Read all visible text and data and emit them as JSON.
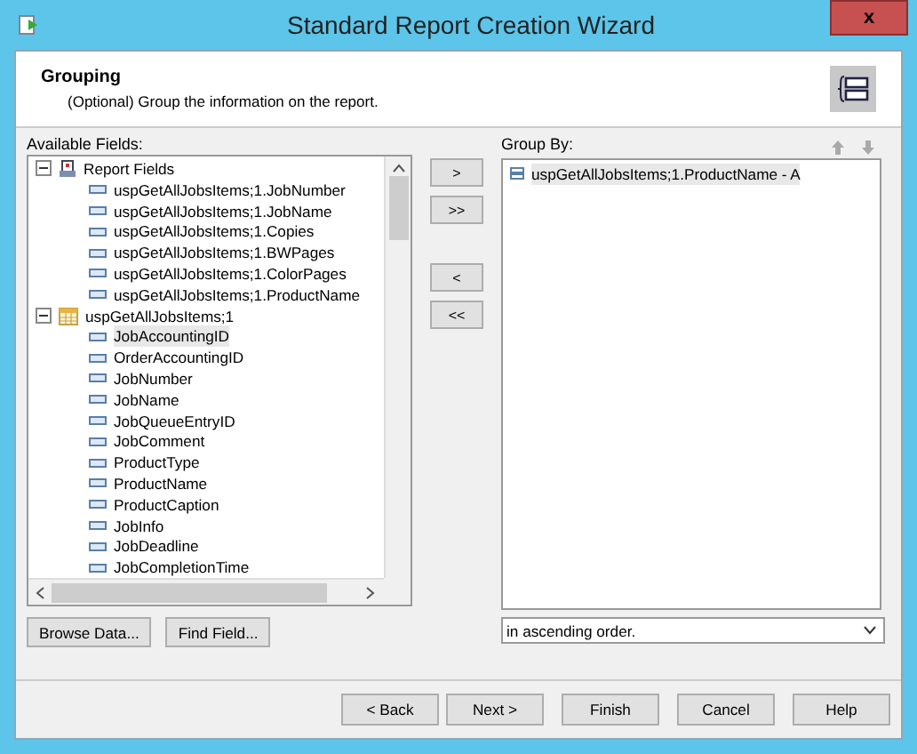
{
  "window": {
    "title": "Standard Report Creation Wizard",
    "close": "x"
  },
  "header": {
    "title": "Grouping",
    "subtitle": "(Optional) Group the information on the report."
  },
  "available_fields": {
    "label": "Available Fields:",
    "tree": [
      {
        "label": "Report Fields",
        "kind": "report",
        "expanded": true,
        "children": [
          {
            "label": "uspGetAllJobsItems;1.JobNumber",
            "selected": false
          },
          {
            "label": "uspGetAllJobsItems;1.JobName",
            "selected": false
          },
          {
            "label": "uspGetAllJobsItems;1.Copies",
            "selected": false
          },
          {
            "label": "uspGetAllJobsItems;1.BWPages",
            "selected": false
          },
          {
            "label": "uspGetAllJobsItems;1.ColorPages",
            "selected": false
          },
          {
            "label": "uspGetAllJobsItems;1.ProductName",
            "selected": false
          }
        ]
      },
      {
        "label": "uspGetAllJobsItems;1",
        "kind": "table",
        "expanded": true,
        "children": [
          {
            "label": "JobAccountingID",
            "selected": true
          },
          {
            "label": "OrderAccountingID",
            "selected": false
          },
          {
            "label": "JobNumber",
            "selected": false
          },
          {
            "label": "JobName",
            "selected": false
          },
          {
            "label": "JobQueueEntryID",
            "selected": false
          },
          {
            "label": "JobComment",
            "selected": false
          },
          {
            "label": "ProductType",
            "selected": false
          },
          {
            "label": "ProductName",
            "selected": false
          },
          {
            "label": "ProductCaption",
            "selected": false
          },
          {
            "label": "JobInfo",
            "selected": false
          },
          {
            "label": "JobDeadline",
            "selected": false
          },
          {
            "label": "JobCompletionTime",
            "selected": false
          }
        ]
      }
    ]
  },
  "transfer_buttons": [
    ">",
    ">>",
    "<",
    "<<"
  ],
  "group_by": {
    "label": "Group By:",
    "items": [
      {
        "label": "uspGetAllJobsItems;1.ProductName - A",
        "selected": true
      }
    ],
    "order": "in ascending order."
  },
  "field_buttons": [
    "Browse Data...",
    "Find Field..."
  ],
  "nav_buttons": [
    "< Back",
    "Next >",
    "Finish",
    "Cancel",
    "Help"
  ]
}
